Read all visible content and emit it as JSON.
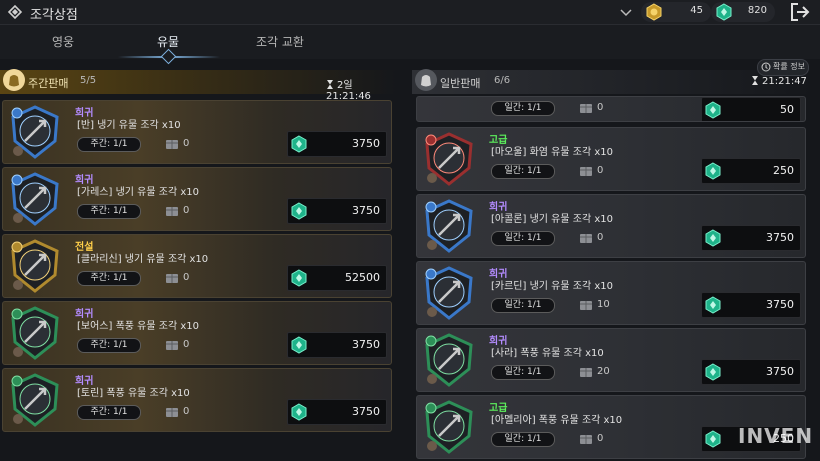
{
  "header": {
    "title": "조각상점",
    "currencies": [
      {
        "icon": "gold-coin-icon",
        "value": "45"
      },
      {
        "icon": "green-gem-icon",
        "value": "820"
      }
    ]
  },
  "tabs": [
    {
      "label": "영웅",
      "active": false
    },
    {
      "label": "유물",
      "active": true
    },
    {
      "label": "조각 교환",
      "active": false
    }
  ],
  "prob_button": "확률 정보",
  "weekly": {
    "title": "주간판매",
    "count": "5/5",
    "timer": "2일 21:21:46",
    "items": [
      {
        "rarity": "희귀",
        "rarity_class": "r-epic",
        "name": "[반] 냉기 유물 조각 x10",
        "limit": "주간: 1/1",
        "stock": "0",
        "price": "3750",
        "frame": "blue"
      },
      {
        "rarity": "희귀",
        "rarity_class": "r-epic",
        "name": "[가레스] 냉기 유물 조각 x10",
        "limit": "주간: 1/1",
        "stock": "0",
        "price": "3750",
        "frame": "blue"
      },
      {
        "rarity": "전설",
        "rarity_class": "r-legend",
        "name": "[클라리신] 냉기 유물 조각 x10",
        "limit": "주간: 1/1",
        "stock": "0",
        "price": "52500",
        "frame": "gold"
      },
      {
        "rarity": "희귀",
        "rarity_class": "r-epic",
        "name": "[보어스] 폭풍 유물 조각 x10",
        "limit": "주간: 1/1",
        "stock": "0",
        "price": "3750",
        "frame": "green"
      },
      {
        "rarity": "희귀",
        "rarity_class": "r-epic",
        "name": "[토린] 폭풍 유물 조각 x10",
        "limit": "주간: 1/1",
        "stock": "0",
        "price": "3750",
        "frame": "green"
      }
    ]
  },
  "daily": {
    "title": "일반판매",
    "count": "6/6",
    "timer": "21:21:47",
    "partial": {
      "limit": "일간: 1/1",
      "stock": "0",
      "price": "50"
    },
    "items": [
      {
        "rarity": "고급",
        "rarity_class": "r-adv",
        "name": "[마오울] 화염 유물 조각 x10",
        "limit": "일간: 1/1",
        "stock": "0",
        "price": "250",
        "frame": "red"
      },
      {
        "rarity": "희귀",
        "rarity_class": "r-epic",
        "name": "[아콜론] 냉기 유물 조각 x10",
        "limit": "일간: 1/1",
        "stock": "0",
        "price": "3750",
        "frame": "blue"
      },
      {
        "rarity": "희귀",
        "rarity_class": "r-epic",
        "name": "[카르딘] 냉기 유물 조각 x10",
        "limit": "일간: 1/1",
        "stock": "10",
        "price": "3750",
        "frame": "blue"
      },
      {
        "rarity": "희귀",
        "rarity_class": "r-epic",
        "name": "[사라] 폭풍 유물 조각 x10",
        "limit": "일간: 1/1",
        "stock": "20",
        "price": "3750",
        "frame": "green"
      },
      {
        "rarity": "고급",
        "rarity_class": "r-adv",
        "name": "[아멜리아] 폭풍 유물 조각 x10",
        "limit": "일간: 1/1",
        "stock": "0",
        "price": "250",
        "frame": "green"
      }
    ]
  },
  "watermark": "INVEN",
  "colors": {
    "accent": "#7fb2e0",
    "epic": "#b48cff",
    "legend": "#ffcf4a",
    "advanced": "#5cf05c",
    "gem": "#1fb38a"
  }
}
